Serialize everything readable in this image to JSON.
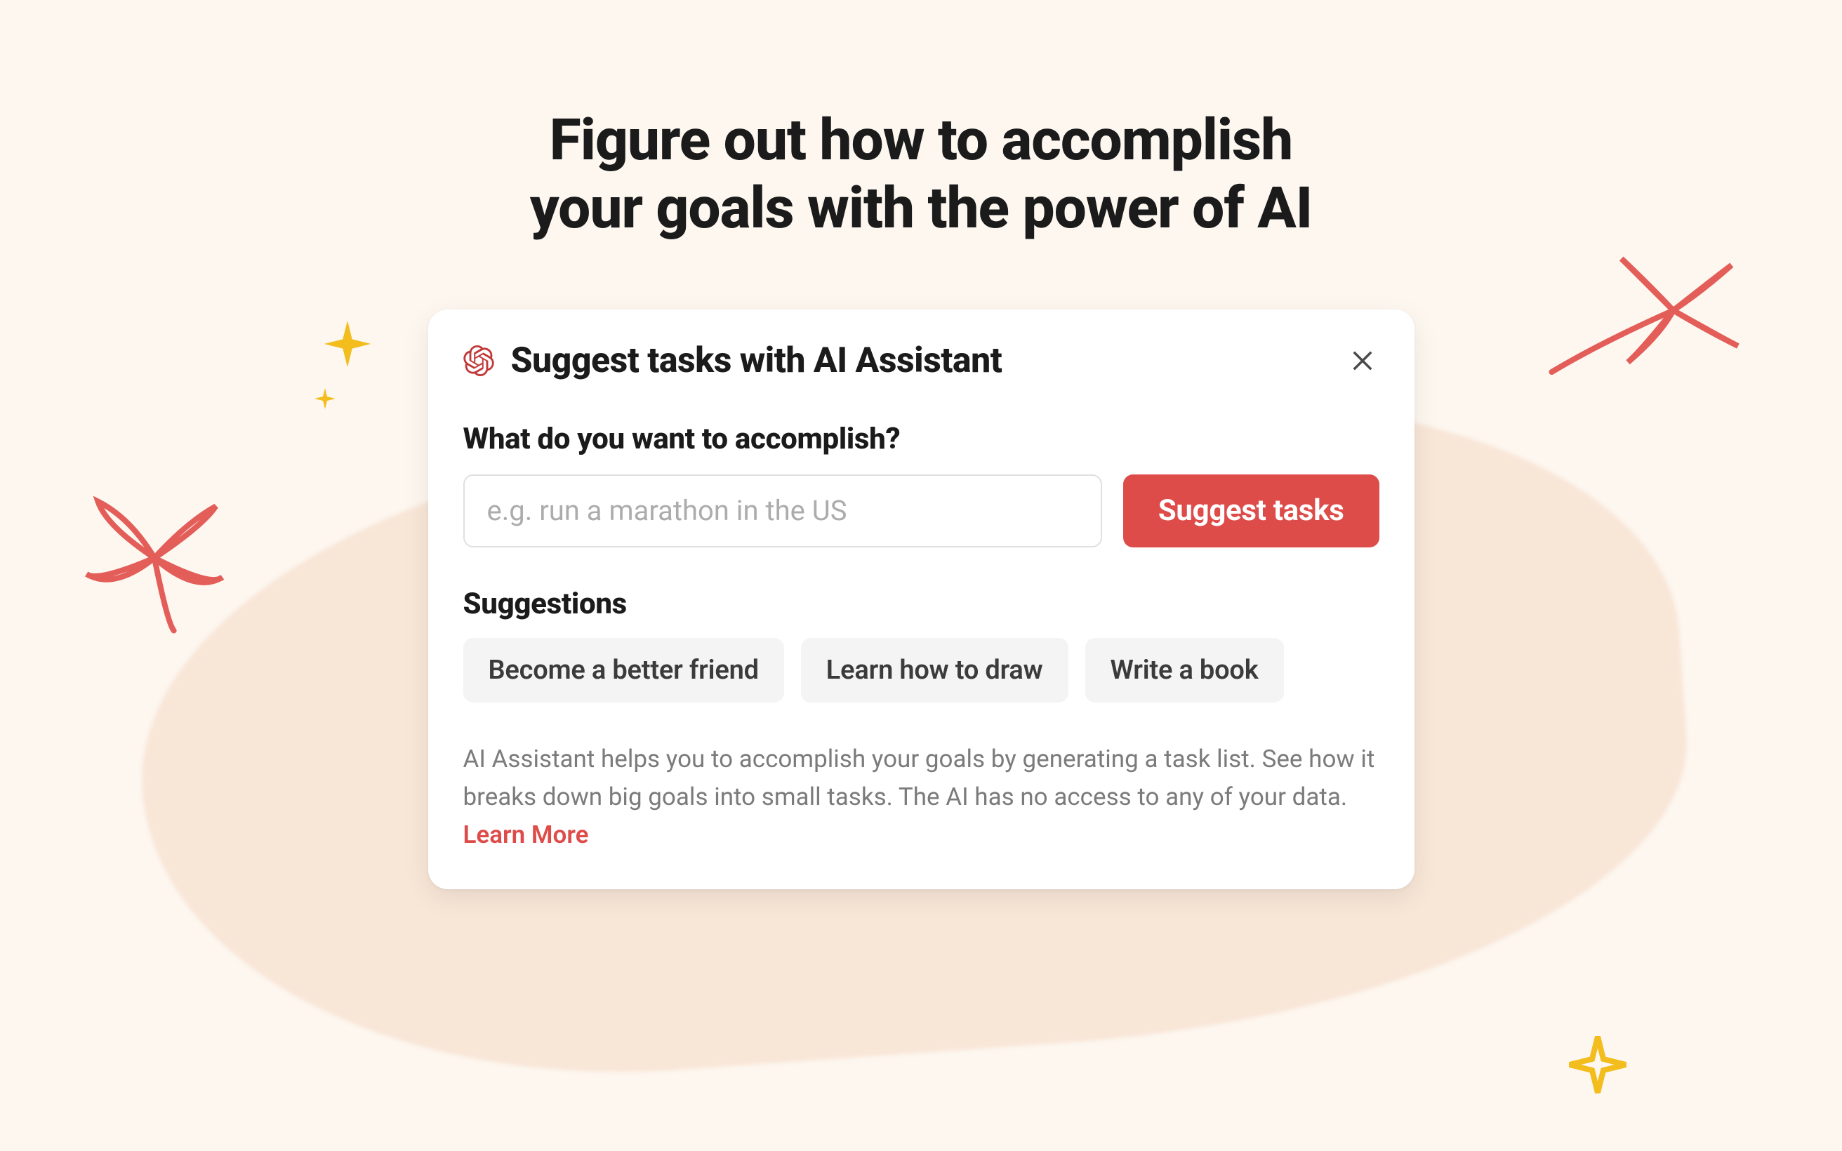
{
  "heading": {
    "line1": "Figure out how to accomplish",
    "line2": "your goals with the power of AI"
  },
  "modal": {
    "title": "Suggest tasks with AI Assistant",
    "prompt_label": "What do you want to accomplish?",
    "input_placeholder": "e.g. run a marathon in the US",
    "submit_label": "Suggest tasks",
    "suggestions_label": "Suggestions",
    "chips": [
      "Become a better friend",
      "Learn how to draw",
      "Write a book"
    ],
    "disclaimer_text": "AI Assistant helps you to accomplish your goals by generating a task list. See how it breaks down big goals into small tasks. The AI has no access to any of your data. ",
    "learn_more_label": "Learn More"
  },
  "icons": {
    "ai": "openai-icon",
    "close": "close-icon",
    "sparkle": "sparkle-icon",
    "flower": "flower-icon"
  },
  "colors": {
    "accent": "#DE4C4A",
    "ai_icon": "#C13A3A",
    "sparkle": "#F2BD1D",
    "flower": "#E35E59",
    "bg": "#FDF7F0"
  }
}
